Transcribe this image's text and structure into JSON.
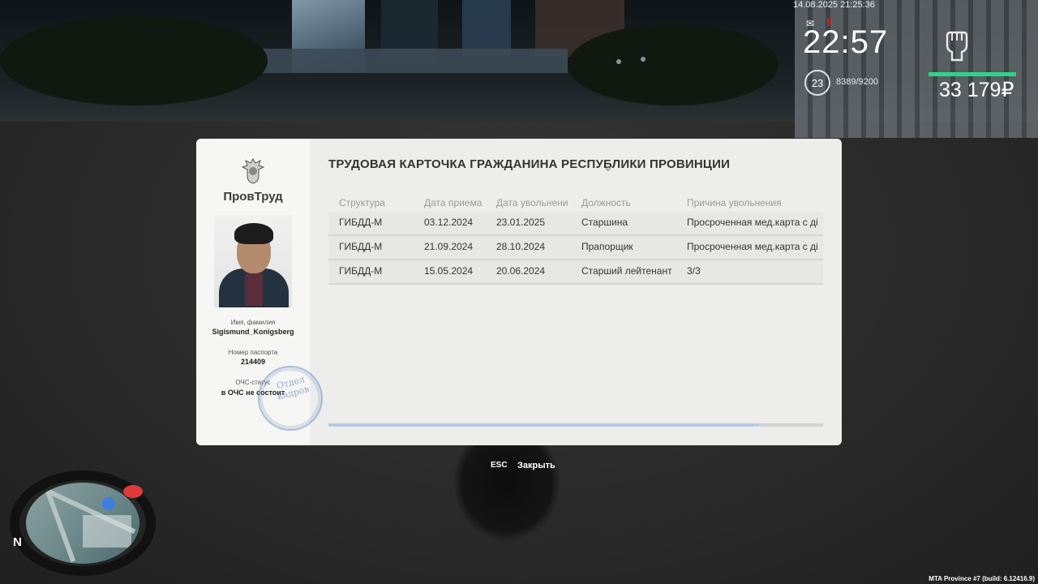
{
  "hud": {
    "datetime": "14.08.2025 21:25:36",
    "mail_icon": "mail-icon",
    "alert_icon": "alert-icon",
    "time": "22:57",
    "level": "23",
    "xp": "8389/9200",
    "fist_icon": "fist-icon",
    "money": "33 179₽",
    "health_color": "#2cd688"
  },
  "card": {
    "org_name": "ПровТруд",
    "title": "ТРУДОВАЯ КАРТОЧКА ГРАЖДАНИНА РЕСПУБЛИКИ ПРОВИНЦИИ",
    "name_label": "Имя, фамилия",
    "name_value": "Sigismund_Konigsberg",
    "passport_label": "Номер паспорта",
    "passport_value": "214409",
    "ochs_label": "ОЧС-статус",
    "ochs_value": "в ОЧС не состоит",
    "stamp_text": "Отдел кадров",
    "columns": [
      "Структура",
      "Дата приема",
      "Дата увольнени",
      "Должность",
      "Причина увольнения"
    ],
    "rows": [
      [
        "ГИБДД-М",
        "03.12.2024",
        "23.01.2025",
        "Старшина",
        "Просроченная мед.карта с ді"
      ],
      [
        "ГИБДД-М",
        "21.09.2024",
        "28.10.2024",
        "Прапорщик",
        "Просроченная мед.карта с ді"
      ],
      [
        "ГИБДД-М",
        "15.05.2024",
        "20.06.2024",
        "Старший лейтенант",
        "3/3"
      ]
    ],
    "scroll_progress": 0.87
  },
  "footer": {
    "esc_key": "ESC",
    "close_label": "Закрыть"
  },
  "minimap": {
    "north_label": "N"
  },
  "build": "MTA Province #7 (build: 6.12416.9)"
}
